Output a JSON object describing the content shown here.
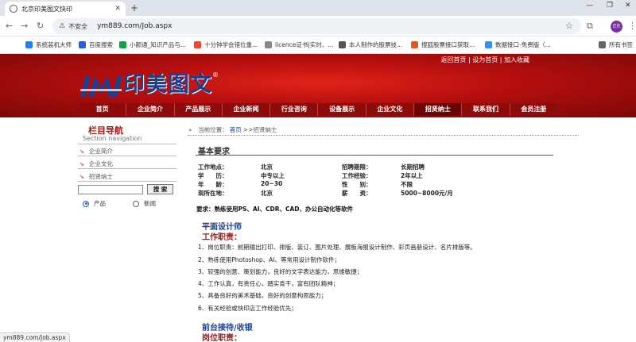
{
  "browser": {
    "tab_title": "北京印美图文快印",
    "insecure_label": "不安全",
    "url": "ym889.com/Job.aspx",
    "avatar_text": "正在",
    "bookmarks": [
      {
        "label": "系统装机大师",
        "color": "#2b7be0"
      },
      {
        "label": "百度搜索",
        "color": "#2e5bd8"
      },
      {
        "label": "小颜通_知识产品与...",
        "color": "#15a048"
      },
      {
        "label": "十分钟学会错位重...",
        "color": "#e24a3b"
      },
      {
        "label": "licence证书|实时、...",
        "color": "#888888"
      },
      {
        "label": "本人制作的股票技...",
        "color": "#555555"
      },
      {
        "label": "搜狐股票接口获取...",
        "color": "#e0572b"
      },
      {
        "label": "数据接口-免费版（...",
        "color": "#3a8ee6"
      },
      {
        "label": "所有书签",
        "color": "#666666"
      }
    ],
    "status_url": "ym889.com/Job.aspx"
  },
  "site": {
    "top_links": [
      "返回首页",
      "设为首页",
      "加入收藏"
    ],
    "logo_text": "印美图文",
    "logo_reg": "®",
    "nav": [
      "首页",
      "企业简介",
      "产品展示",
      "企业新闻",
      "行业咨询",
      "设备展示",
      "企业文化",
      "招贤纳士",
      "联系我们",
      "会员注册"
    ],
    "nav_active_index": 7
  },
  "sidebar": {
    "title": "栏目导航",
    "subtitle": "Section navigation",
    "items": [
      "企业简介",
      "企业文化",
      "招贤纳士"
    ],
    "search_button": "搜 索",
    "radios": [
      {
        "label": "产品",
        "checked": true
      },
      {
        "label": "新闻",
        "checked": false
      }
    ]
  },
  "content": {
    "crumb_prefix": "当前位置：",
    "crumb_home": "首页",
    "crumb_rest": " >>招贤纳士",
    "section_title": "基本要求",
    "requirements": [
      [
        "工作地点：",
        "北京",
        "招聘期限：",
        "长期招聘"
      ],
      [
        "学　　历：",
        "中专以上",
        "工作经验：",
        "2年以上"
      ],
      [
        "年　　龄：",
        "20~30",
        "性　　别：",
        "不限"
      ],
      [
        "现所在地：",
        "北京",
        "薪　　资：",
        "5000~8000元/月"
      ]
    ],
    "req_note": "要求：熟练使用PS、AI、CDR、CAD、办公自动化等软件",
    "job1_title": "平面设计师",
    "job1_duty_title": "工作职责：",
    "job1_duties": [
      "1、岗位职责：前期输出打印、排版、装订、图片处理、展板海报设计制作、彩页画册设计、名片排版等。",
      "2、熟练使用Photoshop、AI、等常用设计制作软件；",
      "3、较强的创意、策划能力，良好的文字表达能力，思维敏捷；",
      "4、工作认真，有责任心，踏实肯干，富有团队精神；",
      "5、具备良好的美术基础，良好的创意构思能力；",
      "6、有关经验或快印店工作经验优先；"
    ],
    "job2_title": "前台接待/收银",
    "job2_duty_title": "岗位职责："
  }
}
